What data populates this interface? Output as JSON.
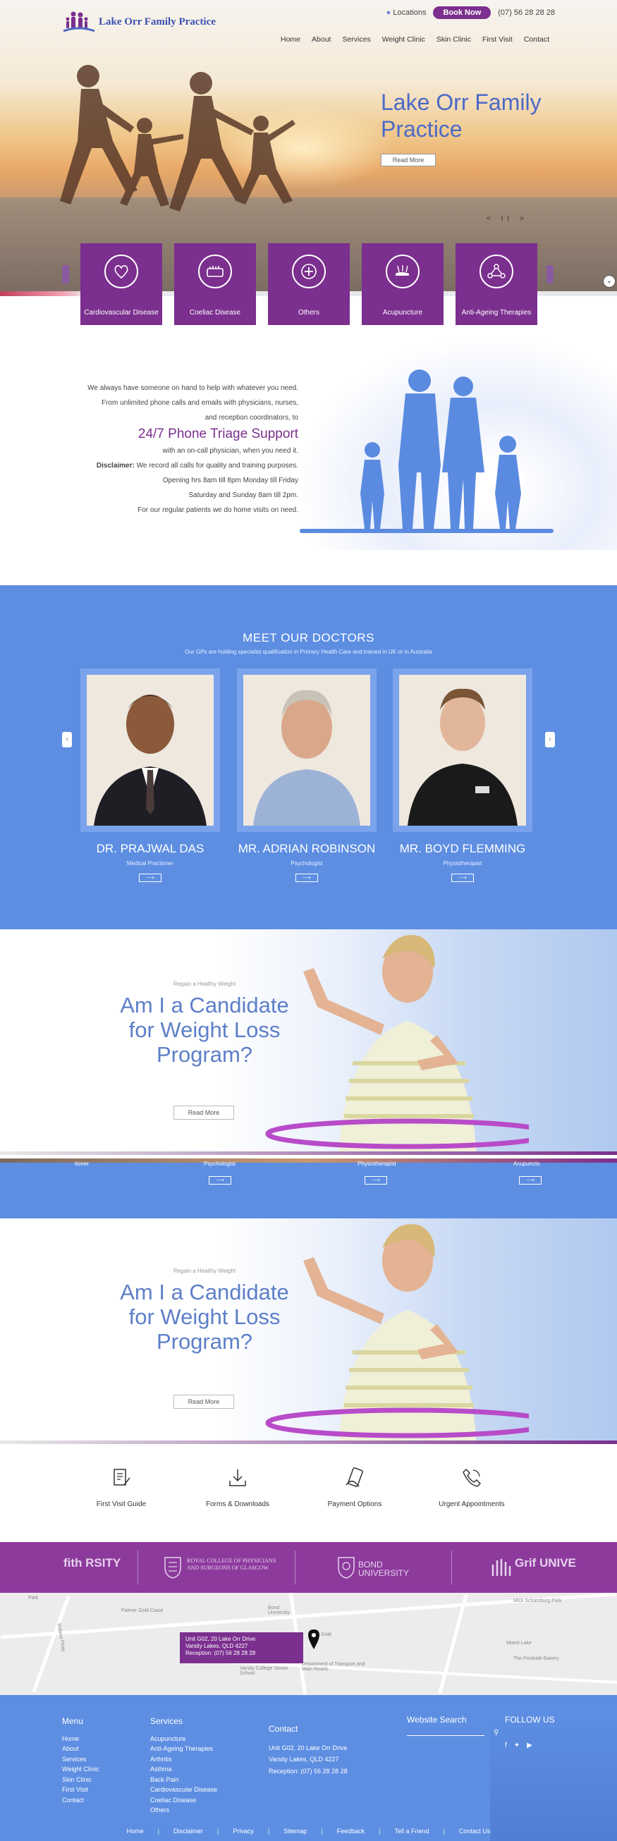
{
  "header": {
    "logo_text": "Lake Orr Family Practice",
    "locations": "Locations",
    "book_now": "Book Now",
    "phone": "(07) 56 28 28 28",
    "nav": [
      "Home",
      "About",
      "Services",
      "Weight Clinic",
      "Skin Clinic",
      "First Visit",
      "Contact"
    ]
  },
  "hero": {
    "title": "Lake Orr Family Practice",
    "read_more": "Read More",
    "controls": "< II >"
  },
  "services": [
    {
      "label": "Cardiovascular Disease",
      "icon": "heart-icon"
    },
    {
      "label": "Coeliac Disease",
      "icon": "bread-icon"
    },
    {
      "label": "Others",
      "icon": "plus-icon"
    },
    {
      "label": "Acupuncture",
      "icon": "acupuncture-icon"
    },
    {
      "label": "Anti-Ageing Therapies",
      "icon": "molecule-icon"
    }
  ],
  "triage": {
    "line1": "We always have someone on hand to help with whatever you need.",
    "line2": "From unlimited phone calls and emails with physicians, nurses,",
    "line3": "and reception coordinators, to",
    "big": "24/7 Phone Triage Support",
    "line4": "with an on-call physician, when you need it.",
    "disclaimer_label": "Disclaimer:",
    "disclaimer": "We record all calls for quality and training purposes.",
    "hours1": "Opening hrs 8am till 8pm Monday till Friday",
    "hours2": "Saturday and Sunday 8am till 2pm.",
    "home_visits": "For our regular patients we do home visits on need."
  },
  "doctors": {
    "title": "MEET OUR DOCTORS",
    "subtitle": "Our GPs are holding specialist qualification in Primary Health Care and trained in UK or in Australia",
    "list": [
      {
        "name": "DR. PRAJWAL DAS",
        "role": "Medical Practioner"
      },
      {
        "name": "MR. ADRIAN ROBINSON",
        "role": "Psychologist"
      },
      {
        "name": "MR. BOYD FLEMMING",
        "role": "Physiotherapist"
      }
    ],
    "button": "⟶"
  },
  "weight": {
    "eyebrow": "Regain a Healthy Weight",
    "headline": "Am I a Candidate for Weight Loss Program?",
    "read_more": "Read More"
  },
  "overlap_roles": [
    "tioner",
    "Psychologist",
    "Physiotherapist",
    "Acupuncts"
  ],
  "quick_links": [
    "First Visit Guide",
    "Forms & Downloads",
    "Payment Options",
    "Urgent Appointments"
  ],
  "logos": [
    "fith RSITY",
    "ROYAL COLLEGE OF PHYSICIANS AND SURGEONS OF GLASGOW",
    "BOND UNIVERSITY",
    "Grif UNIVE"
  ],
  "map": {
    "address1": "Unit G02, 20 Lake Orr Drive",
    "address2": "Varsity Lakes, QLD 4227",
    "reception": "Reception: (07) 56 28 28 28",
    "labels": [
      "Park",
      "Palmer Gold Coast",
      "Robina Pkwy",
      "Bond University",
      "Mick Schamburg Park",
      "Miami Lake",
      "The Poolside Bakery",
      "Varsity College Senior School",
      "Department of Transport and Main Roads",
      "Gold"
    ]
  },
  "footer": {
    "menu_title": "Menu",
    "menu": [
      "Home",
      "About",
      "Services",
      "Weight Clinic",
      "Skin Clinic",
      "First Visit",
      "Contact"
    ],
    "services_title": "Services",
    "services": [
      "Acupuncture",
      "Anti-Ageing Therapies",
      "Arthritis",
      "Asthma",
      "Back Pain",
      "Cardiovascular Disease",
      "Coeliac Disease",
      "Others"
    ],
    "contact_title": "Contact",
    "contact1": "Unit G02, 20 Lake Orr Drive",
    "contact2": "Varsity Lakes, QLD 4227",
    "contact3": "Reception: (07) 56 28 28 28",
    "search_title": "Website Search",
    "follow_title": "FOLLOW US",
    "bottom": [
      "Home",
      "Disclaimer",
      "Privacy",
      "Sitemap",
      "Feedback",
      "Tell a Friend",
      "Contact Us"
    ]
  },
  "colors": {
    "purple": "#7b2f8e",
    "blue": "#5d8ee2",
    "title_blue": "#4c69c7"
  }
}
